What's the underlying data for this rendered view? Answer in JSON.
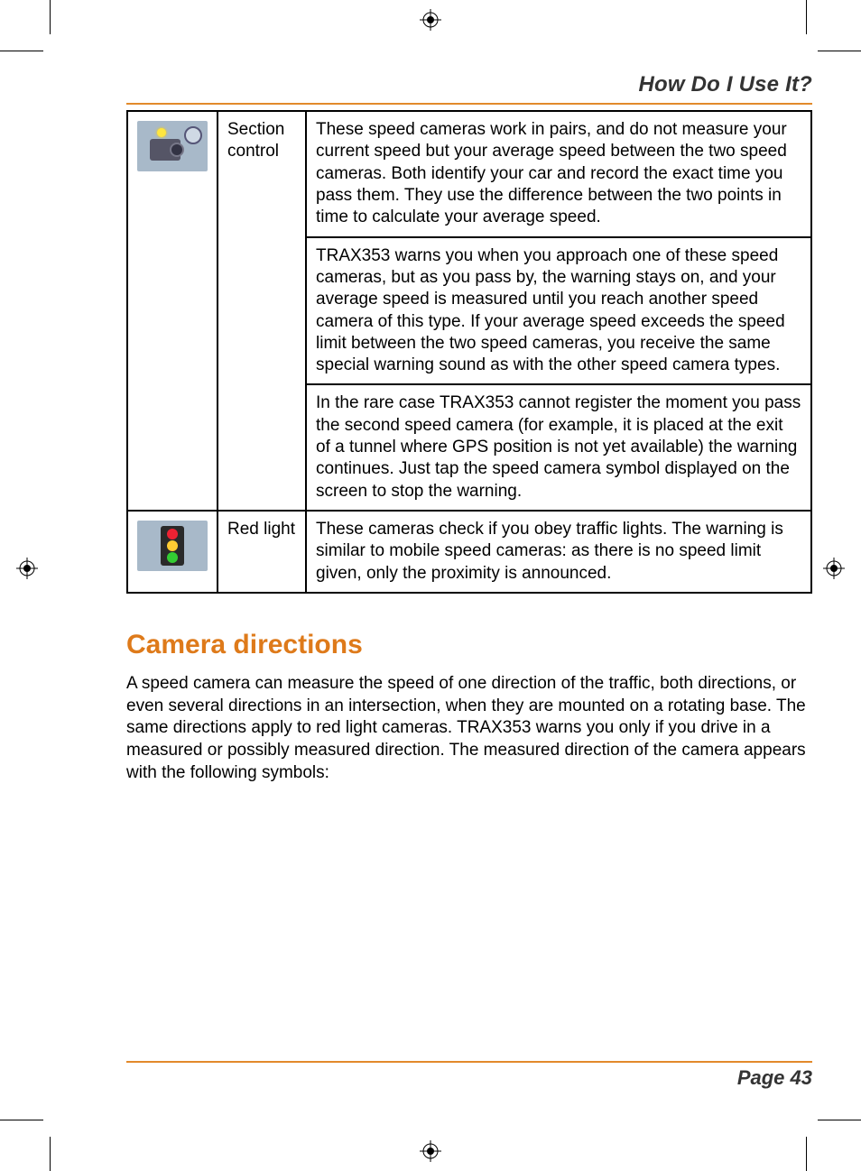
{
  "header": {
    "section_title": "How Do I Use It?"
  },
  "table": {
    "rows": [
      {
        "icon": "section-control-camera",
        "label": "Section control",
        "paras": [
          "These speed cameras work in pairs, and do not measure your current speed but your average speed between the two speed cameras. Both identify your car and record the exact time you pass them. They use the difference between the two points in time to calculate your average speed.",
          "TRAX353 warns you when you approach one of these speed cameras, but as you pass by, the warning stays on, and your average speed is measured until you reach another speed camera of this type. If your average speed exceeds the speed limit between the two speed cameras, you receive the same special warning sound as with the other speed camera types.",
          "In the rare case TRAX353 cannot register the moment you pass the second speed camera (for example, it is placed at the exit of a tunnel where GPS position is not yet available) the warning continues. Just tap the speed camera symbol displayed on the screen to stop the warning."
        ]
      },
      {
        "icon": "red-light-camera",
        "label": "Red light",
        "paras": [
          "These cameras check if you obey traffic lights. The warning is similar to mobile speed cameras: as there is no speed limit given, only the proximity is announced."
        ]
      }
    ]
  },
  "section_heading": "Camera directions",
  "body_paragraph": "A speed camera can measure the speed of one direction of the traffic, both directions, or even several directions in an intersection, when they are mounted on a rotating base. The same directions apply to red light cameras. TRAX353 warns you only if you drive in a measured or possibly measured direction. The measured direction of the camera appears with the following symbols:",
  "footer": {
    "page_label": "Page 43"
  }
}
